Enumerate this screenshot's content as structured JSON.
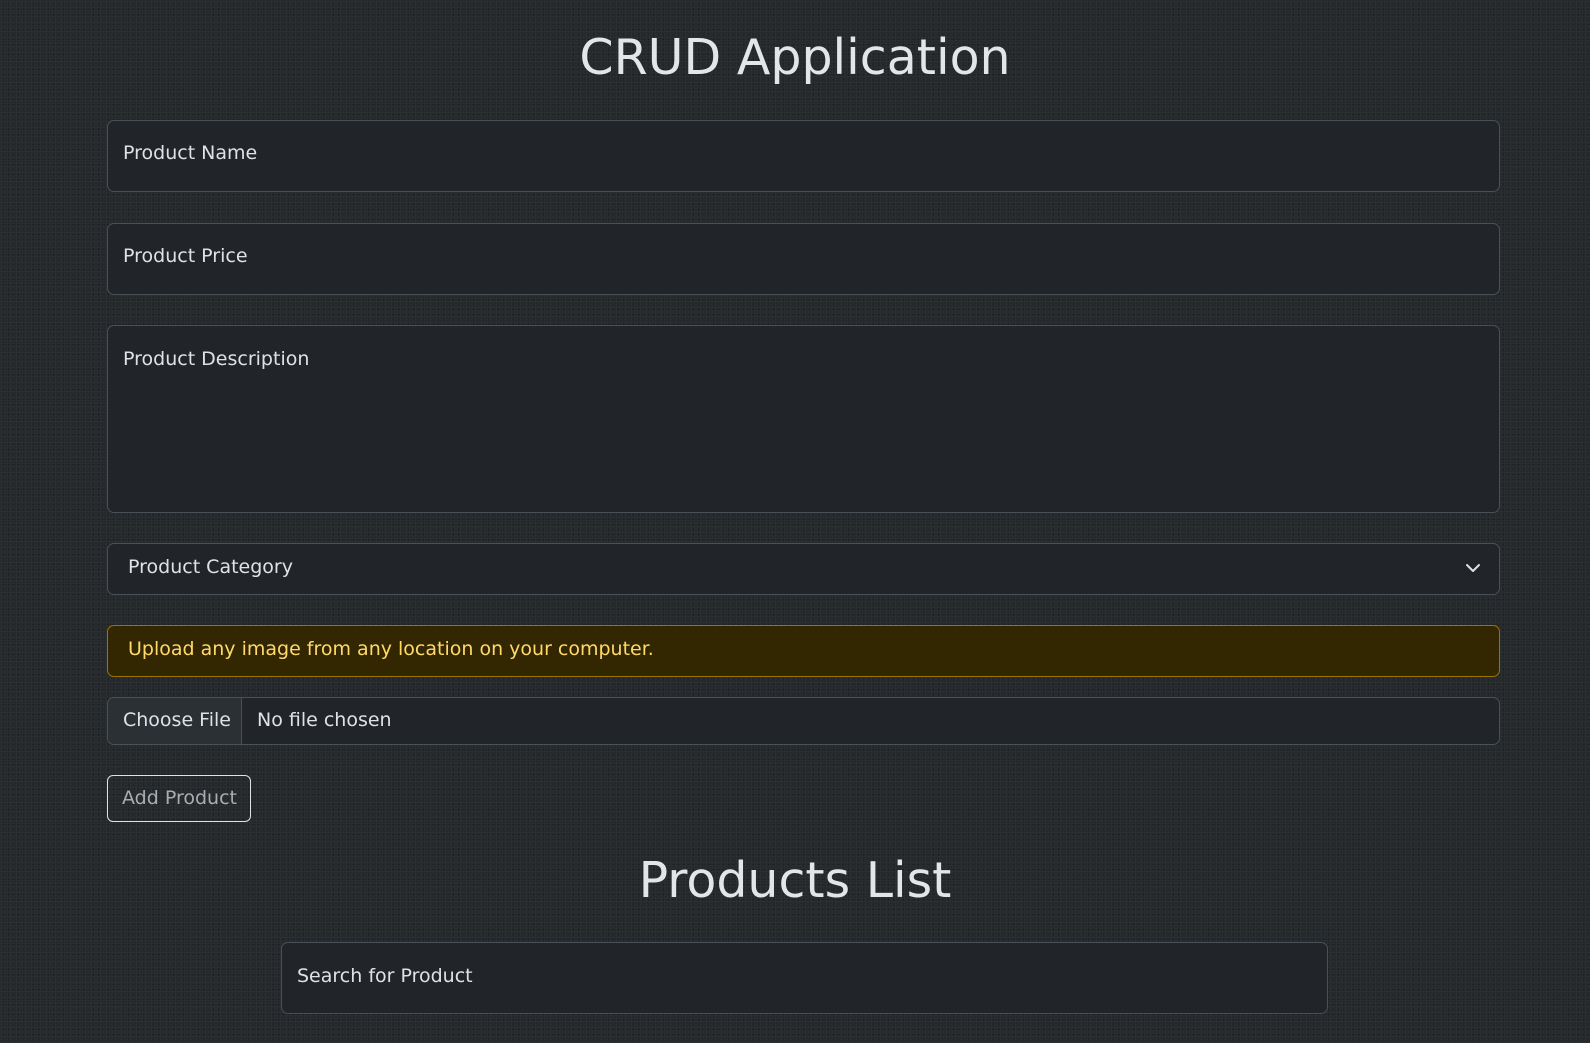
{
  "app": {
    "title": "CRUD Application"
  },
  "form": {
    "name_placeholder": "Product Name",
    "price_placeholder": "Product Price",
    "description_placeholder": "Product Description",
    "category_selected": "Product Category",
    "upload_notice": "Upload any image from any location on your computer.",
    "file_button_label": "Choose File",
    "file_status": "No file chosen",
    "submit_label": "Add Product"
  },
  "list": {
    "title": "Products List",
    "search_placeholder": "Search for Product"
  },
  "icons": {
    "category_dropdown": "chevron-down-icon"
  },
  "colors": {
    "background": "#25292c",
    "field_bg": "#212529",
    "field_border": "#495057",
    "alert_bg": "#332701",
    "alert_border": "#997404",
    "alert_text": "#ffda6a"
  }
}
